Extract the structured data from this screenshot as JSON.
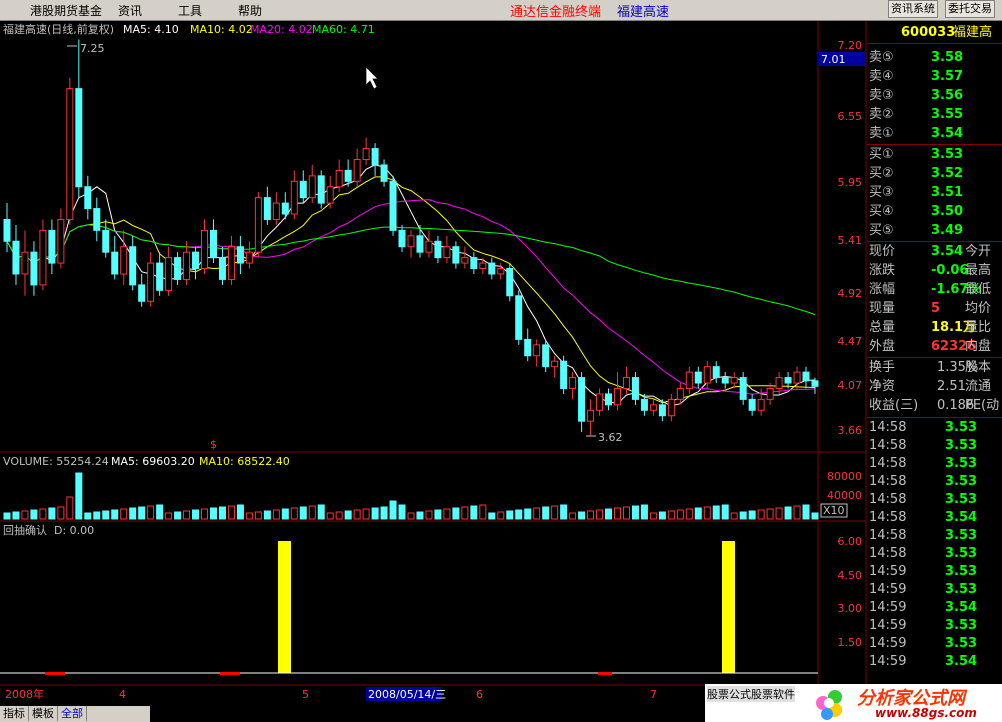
{
  "menu": {
    "items": [
      "港股期货基金",
      "资讯",
      "工具",
      "帮助"
    ],
    "terminal_title": "通达信金融终端",
    "stock_title": "福建高速",
    "btn_news": "资讯系统",
    "btn_trade": "委托交易"
  },
  "main_chart": {
    "title": "福建高速(日线,前复权)",
    "ma5": "MA5: 4.10",
    "ma10": "MA10: 4.02",
    "ma20": "MA20: 4.02",
    "ma60": "MA60: 4.71",
    "high_label": "7.25",
    "low_label": "3.62",
    "y_ticks": [
      "7.20",
      "6.55",
      "5.95",
      "5.41",
      "4.92",
      "4.47",
      "4.07",
      "3.66"
    ],
    "current_price_tag": "7.01",
    "dollar_marker": "$"
  },
  "volume_chart": {
    "label": "VOLUME: 55254.24",
    "ma5": "MA5: 69603.20",
    "ma10": "MA10: 68522.40",
    "y_ticks": [
      "80000",
      "40000"
    ],
    "unit": "X10"
  },
  "indicator_chart": {
    "label": "回抽确认",
    "d_value": "D: 0.00",
    "y_ticks": [
      "6.00",
      "4.50",
      "3.00",
      "1.50"
    ]
  },
  "time_axis": {
    "labels": [
      "2008年",
      "4",
      "5",
      "2008/05/14/三",
      "6",
      "7"
    ]
  },
  "quote_panel": {
    "code": "600033",
    "name": "福建高",
    "sells": [
      {
        "label": "卖⑤",
        "price": "3.58"
      },
      {
        "label": "卖④",
        "price": "3.57"
      },
      {
        "label": "卖③",
        "price": "3.56"
      },
      {
        "label": "卖②",
        "price": "3.55"
      },
      {
        "label": "卖①",
        "price": "3.54"
      }
    ],
    "buys": [
      {
        "label": "买①",
        "price": "3.53"
      },
      {
        "label": "买②",
        "price": "3.52"
      },
      {
        "label": "买③",
        "price": "3.51"
      },
      {
        "label": "买④",
        "price": "3.50"
      },
      {
        "label": "买⑤",
        "price": "3.49"
      }
    ],
    "stats1": [
      {
        "label": "现价",
        "value": "3.54",
        "label2": "今开"
      },
      {
        "label": "涨跌",
        "value": "-0.06",
        "label2": "最高"
      },
      {
        "label": "涨幅",
        "value": "-1.67%",
        "label2": "最低"
      },
      {
        "label": "现量",
        "value": "5",
        "label2": "均价"
      },
      {
        "label": "总量",
        "value": "18.1万",
        "label2": "量比"
      },
      {
        "label": "外盘",
        "value": "62326",
        "label2": "内盘"
      }
    ],
    "stats2": [
      {
        "label": "换手",
        "value": "1.35%",
        "label2": "股本"
      },
      {
        "label": "净资",
        "value": "2.51",
        "label2": "流通"
      },
      {
        "label": "收益(三)",
        "value": "0.186",
        "label2": "PE(动"
      }
    ],
    "ticks": [
      {
        "time": "14:58",
        "price": "3.53"
      },
      {
        "time": "14:58",
        "price": "3.53"
      },
      {
        "time": "14:58",
        "price": "3.53"
      },
      {
        "time": "14:58",
        "price": "3.53"
      },
      {
        "time": "14:58",
        "price": "3.53"
      },
      {
        "time": "14:58",
        "price": "3.54"
      },
      {
        "time": "14:58",
        "price": "3.53"
      },
      {
        "time": "14:58",
        "price": "3.53"
      },
      {
        "time": "14:59",
        "price": "3.53"
      },
      {
        "time": "14:59",
        "price": "3.53"
      },
      {
        "time": "14:59",
        "price": "3.54"
      },
      {
        "time": "14:59",
        "price": "3.53"
      },
      {
        "time": "14:59",
        "price": "3.53"
      },
      {
        "time": "14:59",
        "price": "3.54"
      }
    ]
  },
  "status_tabs": [
    "指标",
    "模板",
    "全部"
  ],
  "watermark": {
    "text1": "股票公式股票软件",
    "text2": "分析家公式网",
    "url": "www.88gs.com"
  },
  "colors": {
    "up": "#ff3232",
    "down": "#54ffff",
    "ma5": "#ffffff",
    "ma10": "#ffff00",
    "ma20": "#ff00ff",
    "ma60": "#00ff00",
    "indicator": "#ffff00",
    "grid": "#800000"
  },
  "chart_data": {
    "type": "candlestick",
    "price_axis": {
      "min": 3.66,
      "max": 7.2
    },
    "candles": [
      [
        5.6,
        5.4,
        5.75,
        5.3
      ],
      [
        5.4,
        5.1,
        5.55,
        5.0
      ],
      [
        5.1,
        5.3,
        5.5,
        4.9
      ],
      [
        5.3,
        5.0,
        5.4,
        4.9
      ],
      [
        5.0,
        5.5,
        5.6,
        4.95
      ],
      [
        5.5,
        5.2,
        5.6,
        5.1
      ],
      [
        5.2,
        5.6,
        5.7,
        5.15
      ],
      [
        5.6,
        6.8,
        6.9,
        5.55
      ],
      [
        6.8,
        5.9,
        7.25,
        5.8
      ],
      [
        5.9,
        5.7,
        6.0,
        5.6
      ],
      [
        5.7,
        5.5,
        5.8,
        5.4
      ],
      [
        5.5,
        5.3,
        5.6,
        5.25
      ],
      [
        5.3,
        5.1,
        5.45,
        5.05
      ],
      [
        5.1,
        5.35,
        5.5,
        5.0
      ],
      [
        5.35,
        5.0,
        5.45,
        4.95
      ],
      [
        5.0,
        4.85,
        5.1,
        4.8
      ],
      [
        4.85,
        5.2,
        5.3,
        4.8
      ],
      [
        5.2,
        4.95,
        5.3,
        4.9
      ],
      [
        4.95,
        5.25,
        5.35,
        4.9
      ],
      [
        5.25,
        5.05,
        5.3,
        5.0
      ],
      [
        5.05,
        5.3,
        5.4,
        5.0
      ],
      [
        5.3,
        5.15,
        5.35,
        5.05
      ],
      [
        5.15,
        5.5,
        5.6,
        5.1
      ],
      [
        5.5,
        5.25,
        5.6,
        5.2
      ],
      [
        5.25,
        5.05,
        5.35,
        5.0
      ],
      [
        5.05,
        5.35,
        5.45,
        5.0
      ],
      [
        5.35,
        5.2,
        5.45,
        5.1
      ],
      [
        5.2,
        5.3,
        5.4,
        5.15
      ],
      [
        5.3,
        5.8,
        5.85,
        5.25
      ],
      [
        5.8,
        5.6,
        5.9,
        5.55
      ],
      [
        5.6,
        5.75,
        5.85,
        5.55
      ],
      [
        5.75,
        5.65,
        5.85,
        5.6
      ],
      [
        5.65,
        5.95,
        6.05,
        5.6
      ],
      [
        5.95,
        5.8,
        6.05,
        5.75
      ],
      [
        5.8,
        6.0,
        6.1,
        5.75
      ],
      [
        6.0,
        5.75,
        6.05,
        5.7
      ],
      [
        5.75,
        5.9,
        6.0,
        5.7
      ],
      [
        5.9,
        6.05,
        6.15,
        5.85
      ],
      [
        6.05,
        5.95,
        6.15,
        5.9
      ],
      [
        5.95,
        6.15,
        6.25,
        5.9
      ],
      [
        6.15,
        6.25,
        6.35,
        6.1
      ],
      [
        6.25,
        6.1,
        6.3,
        6.0
      ],
      [
        6.1,
        5.95,
        6.15,
        5.9
      ],
      [
        5.95,
        5.5,
        6.0,
        5.45
      ],
      [
        5.5,
        5.35,
        5.55,
        5.3
      ],
      [
        5.35,
        5.45,
        5.5,
        5.25
      ],
      [
        5.45,
        5.3,
        5.55,
        5.25
      ],
      [
        5.3,
        5.4,
        5.5,
        5.25
      ],
      [
        5.4,
        5.25,
        5.45,
        5.2
      ],
      [
        5.25,
        5.35,
        5.45,
        5.2
      ],
      [
        5.35,
        5.2,
        5.4,
        5.15
      ],
      [
        5.2,
        5.25,
        5.35,
        5.15
      ],
      [
        5.25,
        5.15,
        5.3,
        5.1
      ],
      [
        5.15,
        5.2,
        5.25,
        5.1
      ],
      [
        5.2,
        5.1,
        5.25,
        5.05
      ],
      [
        5.1,
        5.15,
        5.2,
        5.05
      ],
      [
        5.15,
        4.9,
        5.2,
        4.85
      ],
      [
        4.9,
        4.5,
        4.95,
        4.45
      ],
      [
        4.5,
        4.35,
        4.6,
        4.3
      ],
      [
        4.35,
        4.45,
        4.5,
        4.25
      ],
      [
        4.45,
        4.25,
        4.5,
        4.2
      ],
      [
        4.25,
        4.3,
        4.35,
        4.15
      ],
      [
        4.3,
        4.05,
        4.35,
        4.0
      ],
      [
        4.05,
        4.15,
        4.2,
        3.95
      ],
      [
        4.15,
        3.75,
        4.2,
        3.65
      ],
      [
        3.75,
        3.85,
        3.95,
        3.62
      ],
      [
        3.85,
        4.0,
        4.05,
        3.8
      ],
      [
        4.0,
        3.9,
        4.05,
        3.85
      ],
      [
        3.9,
        4.05,
        4.2,
        3.85
      ],
      [
        4.05,
        4.15,
        4.25,
        4.0
      ],
      [
        4.15,
        3.95,
        4.2,
        3.9
      ],
      [
        3.95,
        3.85,
        4.0,
        3.8
      ],
      [
        3.85,
        3.9,
        3.95,
        3.8
      ],
      [
        3.9,
        3.8,
        3.95,
        3.75
      ],
      [
        3.8,
        3.95,
        4.0,
        3.75
      ],
      [
        3.95,
        4.05,
        4.1,
        3.9
      ],
      [
        4.05,
        4.2,
        4.25,
        4.0
      ],
      [
        4.2,
        4.1,
        4.25,
        4.05
      ],
      [
        4.1,
        4.25,
        4.3,
        4.05
      ],
      [
        4.25,
        4.15,
        4.3,
        4.1
      ],
      [
        4.15,
        4.1,
        4.2,
        4.05
      ],
      [
        4.1,
        4.15,
        4.2,
        4.05
      ],
      [
        4.15,
        3.95,
        4.2,
        3.9
      ],
      [
        3.95,
        3.85,
        4.0,
        3.8
      ],
      [
        3.85,
        3.95,
        4.05,
        3.8
      ],
      [
        3.95,
        4.05,
        4.1,
        3.9
      ],
      [
        4.05,
        4.15,
        4.2,
        4.0
      ],
      [
        4.15,
        4.1,
        4.2,
        4.05
      ],
      [
        4.1,
        4.2,
        4.25,
        4.05
      ],
      [
        4.2,
        4.12,
        4.25,
        4.05
      ],
      [
        4.12,
        4.07,
        4.15,
        4.0
      ]
    ]
  }
}
